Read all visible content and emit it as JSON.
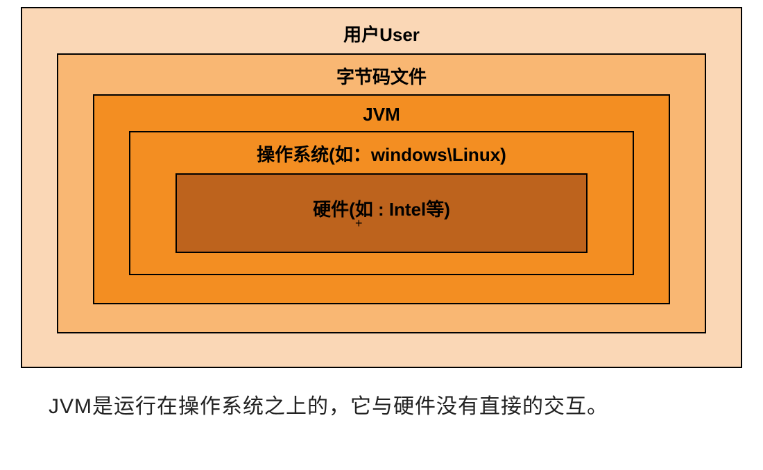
{
  "layers": [
    {
      "label": "用户User",
      "color": "#fad7b6"
    },
    {
      "label": "字节码文件",
      "color": "#f9b773"
    },
    {
      "label": "JVM",
      "color": "#f38e22"
    },
    {
      "label": "操作系统(如：windows\\Linux)",
      "color": "#f38e22"
    },
    {
      "label": "硬件(如  : Intel等)",
      "color": "#bd631d"
    }
  ],
  "cursor_symbol": "+",
  "caption": "JVM是运行在操作系统之上的，它与硬件没有直接的交互。"
}
